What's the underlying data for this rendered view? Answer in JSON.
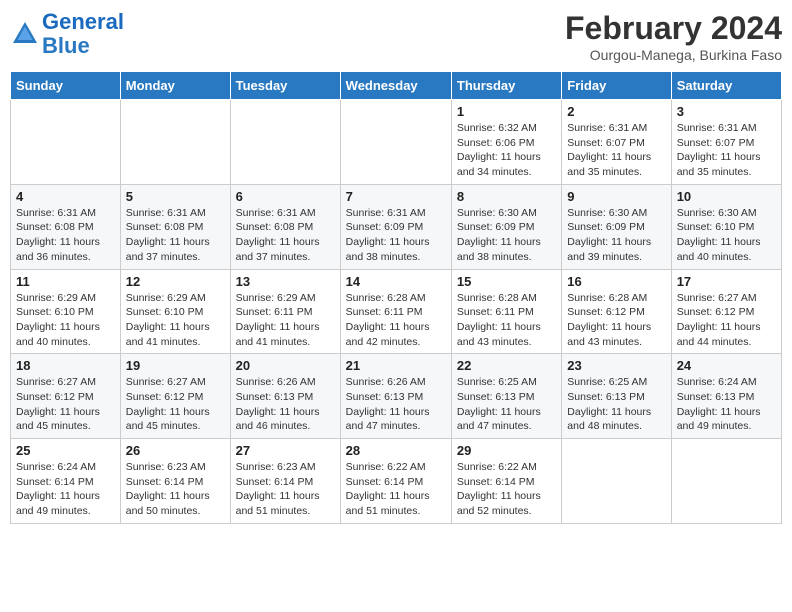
{
  "header": {
    "logo_line1": "General",
    "logo_line2": "Blue",
    "month_title": "February 2024",
    "location": "Ourgou-Manega, Burkina Faso"
  },
  "days_of_week": [
    "Sunday",
    "Monday",
    "Tuesday",
    "Wednesday",
    "Thursday",
    "Friday",
    "Saturday"
  ],
  "weeks": [
    [
      {
        "day": "",
        "info": ""
      },
      {
        "day": "",
        "info": ""
      },
      {
        "day": "",
        "info": ""
      },
      {
        "day": "",
        "info": ""
      },
      {
        "day": "1",
        "info": "Sunrise: 6:32 AM\nSunset: 6:06 PM\nDaylight: 11 hours and 34 minutes."
      },
      {
        "day": "2",
        "info": "Sunrise: 6:31 AM\nSunset: 6:07 PM\nDaylight: 11 hours and 35 minutes."
      },
      {
        "day": "3",
        "info": "Sunrise: 6:31 AM\nSunset: 6:07 PM\nDaylight: 11 hours and 35 minutes."
      }
    ],
    [
      {
        "day": "4",
        "info": "Sunrise: 6:31 AM\nSunset: 6:08 PM\nDaylight: 11 hours and 36 minutes."
      },
      {
        "day": "5",
        "info": "Sunrise: 6:31 AM\nSunset: 6:08 PM\nDaylight: 11 hours and 37 minutes."
      },
      {
        "day": "6",
        "info": "Sunrise: 6:31 AM\nSunset: 6:08 PM\nDaylight: 11 hours and 37 minutes."
      },
      {
        "day": "7",
        "info": "Sunrise: 6:31 AM\nSunset: 6:09 PM\nDaylight: 11 hours and 38 minutes."
      },
      {
        "day": "8",
        "info": "Sunrise: 6:30 AM\nSunset: 6:09 PM\nDaylight: 11 hours and 38 minutes."
      },
      {
        "day": "9",
        "info": "Sunrise: 6:30 AM\nSunset: 6:09 PM\nDaylight: 11 hours and 39 minutes."
      },
      {
        "day": "10",
        "info": "Sunrise: 6:30 AM\nSunset: 6:10 PM\nDaylight: 11 hours and 40 minutes."
      }
    ],
    [
      {
        "day": "11",
        "info": "Sunrise: 6:29 AM\nSunset: 6:10 PM\nDaylight: 11 hours and 40 minutes."
      },
      {
        "day": "12",
        "info": "Sunrise: 6:29 AM\nSunset: 6:10 PM\nDaylight: 11 hours and 41 minutes."
      },
      {
        "day": "13",
        "info": "Sunrise: 6:29 AM\nSunset: 6:11 PM\nDaylight: 11 hours and 41 minutes."
      },
      {
        "day": "14",
        "info": "Sunrise: 6:28 AM\nSunset: 6:11 PM\nDaylight: 11 hours and 42 minutes."
      },
      {
        "day": "15",
        "info": "Sunrise: 6:28 AM\nSunset: 6:11 PM\nDaylight: 11 hours and 43 minutes."
      },
      {
        "day": "16",
        "info": "Sunrise: 6:28 AM\nSunset: 6:12 PM\nDaylight: 11 hours and 43 minutes."
      },
      {
        "day": "17",
        "info": "Sunrise: 6:27 AM\nSunset: 6:12 PM\nDaylight: 11 hours and 44 minutes."
      }
    ],
    [
      {
        "day": "18",
        "info": "Sunrise: 6:27 AM\nSunset: 6:12 PM\nDaylight: 11 hours and 45 minutes."
      },
      {
        "day": "19",
        "info": "Sunrise: 6:27 AM\nSunset: 6:12 PM\nDaylight: 11 hours and 45 minutes."
      },
      {
        "day": "20",
        "info": "Sunrise: 6:26 AM\nSunset: 6:13 PM\nDaylight: 11 hours and 46 minutes."
      },
      {
        "day": "21",
        "info": "Sunrise: 6:26 AM\nSunset: 6:13 PM\nDaylight: 11 hours and 47 minutes."
      },
      {
        "day": "22",
        "info": "Sunrise: 6:25 AM\nSunset: 6:13 PM\nDaylight: 11 hours and 47 minutes."
      },
      {
        "day": "23",
        "info": "Sunrise: 6:25 AM\nSunset: 6:13 PM\nDaylight: 11 hours and 48 minutes."
      },
      {
        "day": "24",
        "info": "Sunrise: 6:24 AM\nSunset: 6:13 PM\nDaylight: 11 hours and 49 minutes."
      }
    ],
    [
      {
        "day": "25",
        "info": "Sunrise: 6:24 AM\nSunset: 6:14 PM\nDaylight: 11 hours and 49 minutes."
      },
      {
        "day": "26",
        "info": "Sunrise: 6:23 AM\nSunset: 6:14 PM\nDaylight: 11 hours and 50 minutes."
      },
      {
        "day": "27",
        "info": "Sunrise: 6:23 AM\nSunset: 6:14 PM\nDaylight: 11 hours and 51 minutes."
      },
      {
        "day": "28",
        "info": "Sunrise: 6:22 AM\nSunset: 6:14 PM\nDaylight: 11 hours and 51 minutes."
      },
      {
        "day": "29",
        "info": "Sunrise: 6:22 AM\nSunset: 6:14 PM\nDaylight: 11 hours and 52 minutes."
      },
      {
        "day": "",
        "info": ""
      },
      {
        "day": "",
        "info": ""
      }
    ]
  ]
}
